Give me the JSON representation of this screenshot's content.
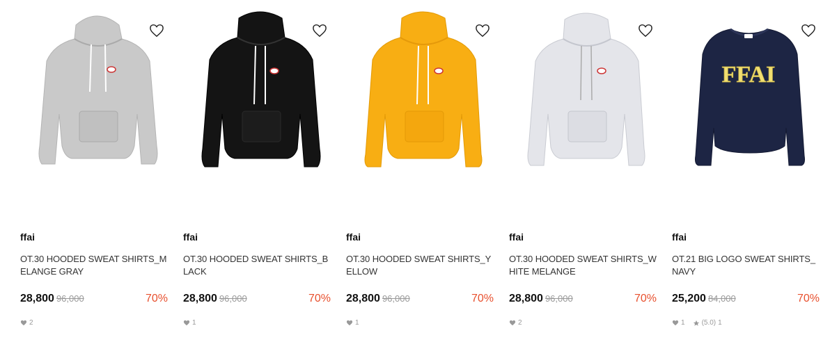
{
  "products": [
    {
      "brand": "ffai",
      "name": "OT.30 HOODED SWEAT SHIRTS_MELANGE GRAY",
      "price": "28,800",
      "original_price": "96,000",
      "discount": "70%",
      "likes": "2",
      "color": "#c9c9c9",
      "image_desc": "gray hooded sweatshirt"
    },
    {
      "brand": "ffai",
      "name": "OT.30 HOODED SWEAT SHIRTS_BLACK",
      "price": "28,800",
      "original_price": "96,000",
      "discount": "70%",
      "likes": "1",
      "color": "#141414",
      "image_desc": "black hooded sweatshirt"
    },
    {
      "brand": "ffai",
      "name": "OT.30 HOODED SWEAT SHIRTS_YELLOW",
      "price": "28,800",
      "original_price": "96,000",
      "discount": "70%",
      "likes": "1",
      "color": "#f8ae13",
      "image_desc": "yellow hooded sweatshirt"
    },
    {
      "brand": "ffai",
      "name": "OT.30 HOODED SWEAT SHIRTS_WHITE MELANGE",
      "price": "28,800",
      "original_price": "96,000",
      "discount": "70%",
      "likes": "2",
      "color": "#e4e5ea",
      "image_desc": "white melange hooded sweatshirt"
    },
    {
      "brand": "ffai",
      "name": "OT.21 BIG LOGO SWEAT SHIRTS_NAVY",
      "price": "25,200",
      "original_price": "84,000",
      "discount": "70%",
      "likes": "1",
      "rating": "(5.0)",
      "reviews": "1",
      "color": "#1d2544",
      "logo_text": "FFAI",
      "logo_color": "#f2df70",
      "image_desc": "navy crewneck sweatshirt with FFAI logo"
    }
  ],
  "icons": {
    "wishlist": "heart-outline-icon",
    "likes": "heart-filled-icon",
    "rating": "star-icon"
  },
  "colors": {
    "discount": "#e8502e",
    "muted": "#999999"
  }
}
